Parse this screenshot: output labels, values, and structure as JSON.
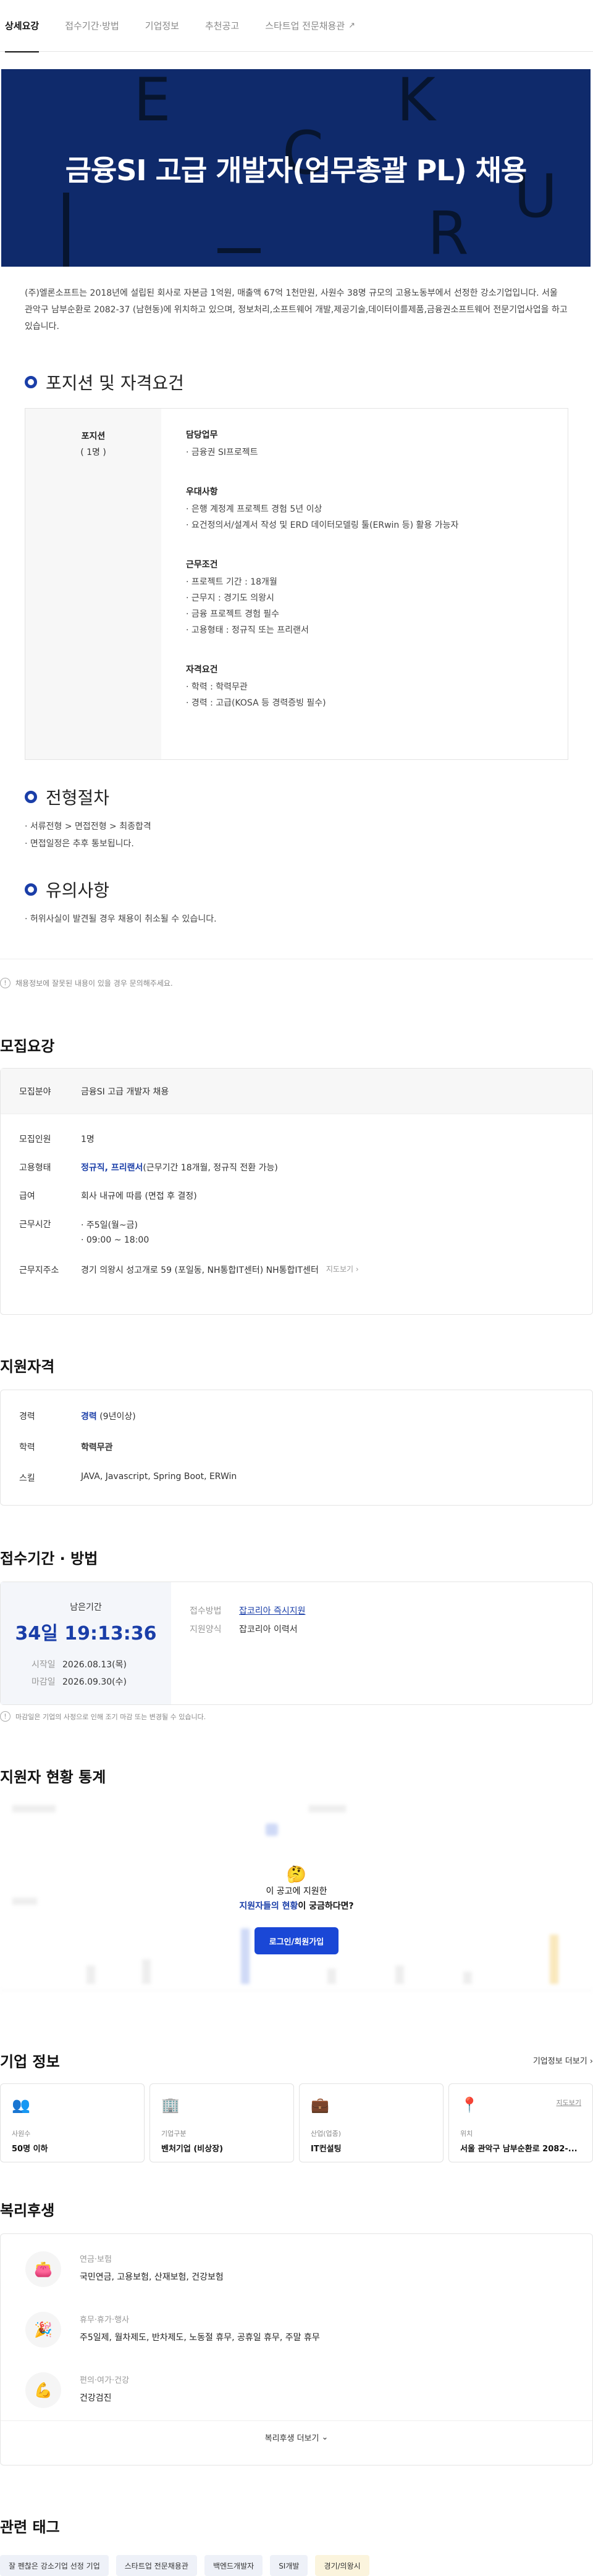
{
  "tabs": [
    {
      "label": "상세요강"
    },
    {
      "label": "접수기간·방법"
    },
    {
      "label": "기업정보"
    },
    {
      "label": "추천공고"
    },
    {
      "label": "스타트업 전문채용관"
    }
  ],
  "hero": {
    "title": "금융SI 고급 개발자(업무총괄 PL) 채용",
    "bg_color": "#0f2a6b"
  },
  "intro": "(주)엘론소프트는 2018년에 설립된 회사로 자본금 1억원, 매출액 67억 1천만원, 사원수 38명 규모의 고용노동부에서 선정한 강소기업입니다. 서울 관악구 남부순환로 2082-37 (남현동)에 위치하고 있으며, 정보처리,소프트웨어 개발,제공기술,데이터이를제품,금융권소프트웨어 전문기업사업을 하고 있습니다.",
  "position": {
    "section_title": "포지션 및 자격요건",
    "left_title": "포지션",
    "left_count": "( 1명 )",
    "groups": [
      {
        "title": "담당업무",
        "items": [
          "· 금융권 SI프로젝트"
        ]
      },
      {
        "title": "우대사항",
        "items": [
          "· 은행 계정계 프로젝트 경험 5년 이상",
          "· 요건정의서/설계서 작성 및 ERD 데이터모델링 툴(ERwin 등) 활용 가능자"
        ]
      },
      {
        "title": "근무조건",
        "items": [
          "· 프로젝트 기간 : 18개월",
          "· 근무지 : 경기도 의왕시",
          "· 금융 프로젝트 경험 필수",
          "· 고용형태 : 정규직 또는 프리랜서"
        ]
      },
      {
        "title": "자격요건",
        "items": [
          "· 학력 : 학력무관",
          "· 경력 : 고급(KOSA 등 경력증빙 필수)"
        ]
      }
    ]
  },
  "process": {
    "section_title": "전형절차",
    "items": [
      "· 서류전형 > 면접전형 > 최종합격",
      "· 면접일정은 추후 통보됩니다."
    ]
  },
  "caution": {
    "section_title": "유의사항",
    "items": [
      "· 허위사실이 발견될 경우 채용이 취소될 수 있습니다."
    ]
  },
  "report_notice": "채용정보에 잘못된 내용이 있을 경우 문의해주세요.",
  "requirements": {
    "title": "모집요강",
    "head_key": "모집분야",
    "head_value": "금융SI 고급 개발자 채용",
    "rows": [
      {
        "k": "모집인원",
        "v": "1명"
      },
      {
        "k": "고용형태",
        "v_blue": "정규직, 프리랜서",
        "v": "(근무기간 18개월, 정규직 전환 가능)"
      },
      {
        "k": "급여",
        "v": "회사 내규에 따름 (면접 후 결정)"
      },
      {
        "k": "근무시간",
        "v1": "· 주5일(월~금)",
        "v2": "· 09:00 ~ 18:00"
      },
      {
        "k": "근무지주소",
        "v": "경기 의왕시 성고개로 59 (포일동, NH통합IT센터) NH통합IT센터",
        "extra": "지도보기 ›"
      }
    ]
  },
  "qualification": {
    "title": "지원자격",
    "rows": [
      {
        "k": "경력",
        "v_blue": "경력",
        "v": " (9년이상)"
      },
      {
        "k": "학력",
        "v_blue": "학력무관"
      },
      {
        "k": "스킬",
        "v": "JAVA, Javascript, Spring Boot, ERWin"
      }
    ]
  },
  "deadline": {
    "title": "접수기간 · 방법",
    "remain_label": "남은기간",
    "remain_time": "34일 19:13:36",
    "start_key": "시작일",
    "start": "2026.08.13(목)",
    "end_key": "마감일",
    "end": "2026.09.30(수)",
    "method_key": "접수방법",
    "method": "잡코리아 즉시지원",
    "form_key": "지원양식",
    "form": "잡코리아 이력서",
    "notice": "마감일은 기업의 사정으로 인해 조기 마감 또는 변경될 수 있습니다."
  },
  "stats": {
    "title": "지원자 현황 통계",
    "q1": "이 공고에 지원한",
    "q2_blue": "지원자들의 현황",
    "q2_rest": "이 궁금하다면?",
    "button": "로그인/회원가입"
  },
  "company": {
    "title": "기업 정보",
    "more": "기업정보 더보기 ›",
    "cards": [
      {
        "icon": "people-icon",
        "label": "사원수",
        "value": "50명 이하"
      },
      {
        "icon": "building-icon",
        "label": "기업구분",
        "value": "벤처기업 (비상장)"
      },
      {
        "icon": "briefcase-icon",
        "label": "산업(업종)",
        "value": "IT컨설팅"
      },
      {
        "icon": "location-icon",
        "label": "위치",
        "value": "서울 관악구 남부순환로 2082-...",
        "extra": "지도보기"
      }
    ]
  },
  "welfare": {
    "title": "복리후생",
    "items": [
      {
        "icon": "wallet-icon",
        "h": "연금·보험",
        "v": "국민연금, 고용보험, 산재보험, 건강보험"
      },
      {
        "icon": "party-icon",
        "h": "휴무·휴가·행사",
        "v": "주5일제, 월차제도, 반차제도, 노동절 휴무, 공휴일 휴무, 주말 휴무"
      },
      {
        "icon": "muscle-icon",
        "h": "편의·여가·건강",
        "v": "건강검진"
      }
    ],
    "more": "복리후생 더보기"
  },
  "tags": {
    "title": "관련 태그",
    "items": [
      "잘 펜찮은 강소기업 선정 기업",
      "스타트업 전문채용관",
      "백엔드개발자",
      "SI개발",
      "경기/의왕시"
    ]
  },
  "colors": {
    "accent": "#1a3ea8",
    "button": "#1a47d6",
    "hero": "#0f2a6b"
  }
}
